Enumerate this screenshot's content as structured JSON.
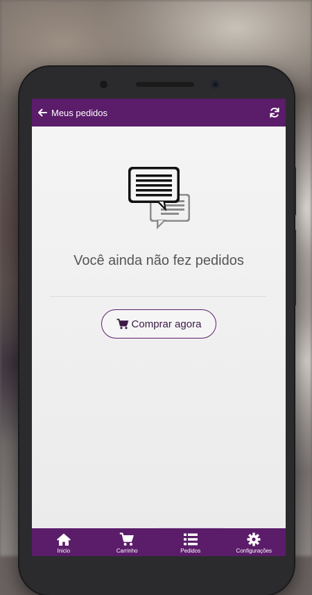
{
  "appbar": {
    "title": "Meus pedidos",
    "back_icon": "arrow-left-icon",
    "refresh_icon": "refresh-icon"
  },
  "empty_state": {
    "icon": "chat-bubbles-icon",
    "message": "Você ainda não fez pedidos",
    "button_label": "Comprar agora",
    "button_icon": "cart-icon"
  },
  "bottom_nav": [
    {
      "label": "Inicio",
      "icon": "home-icon"
    },
    {
      "label": "Carrinho",
      "icon": "cart-icon"
    },
    {
      "label": "Pedidos",
      "icon": "list-icon"
    },
    {
      "label": "Configurações",
      "icon": "gear-icon"
    }
  ],
  "colors": {
    "primary": "#5b1c6a",
    "screen_bg": "#f5f5f5",
    "text": "#555555"
  }
}
